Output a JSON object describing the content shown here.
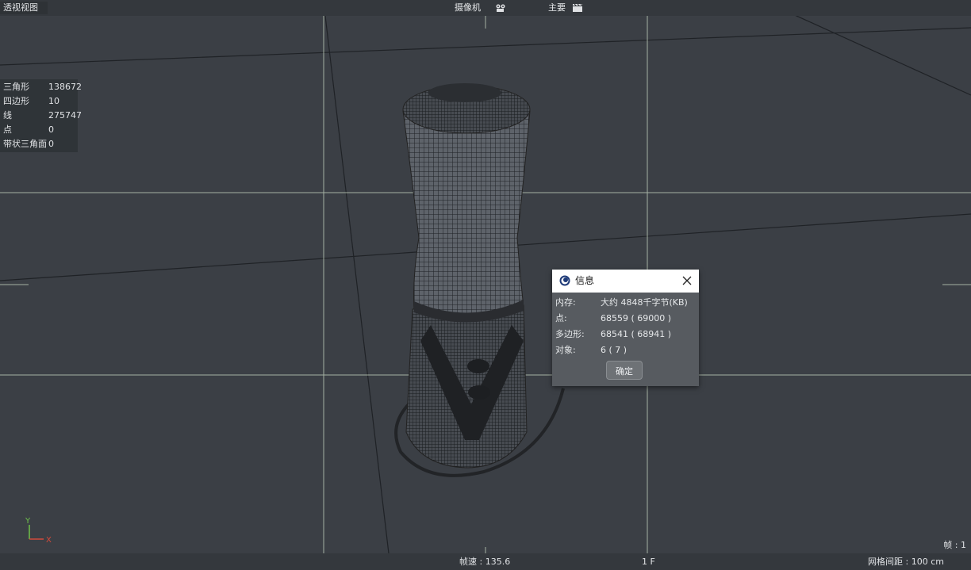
{
  "viewport": {
    "title": "透视视图",
    "camera_label": "摄像机",
    "camera_icon": "camera-icon",
    "display_label": "主要",
    "display_icon": "clapperboard-icon"
  },
  "stats": [
    {
      "label": "三角形",
      "value": "138672"
    },
    {
      "label": "四边形",
      "value": "10"
    },
    {
      "label": "线",
      "value": "275747"
    },
    {
      "label": "点",
      "value": "0"
    },
    {
      "label": "带状三角面",
      "value": "0"
    }
  ],
  "axis": {
    "y_label": "Y",
    "x_label": "X"
  },
  "dialog": {
    "title": "信息",
    "icon": "cinema4d-logo-icon",
    "rows": [
      {
        "label": "内存:",
        "value": "大约 4848千字节(KB)"
      },
      {
        "label": "点:",
        "value": "68559 ( 69000 )"
      },
      {
        "label": "多边形:",
        "value": "68541 ( 68941 )"
      },
      {
        "label": "对象:",
        "value": "6 ( 7 )"
      }
    ],
    "ok_label": "确定"
  },
  "status": {
    "fps": "帧速 : 135.6",
    "frame": "1 F",
    "grid_spacing": "网格间距 : 100 cm",
    "frame_counter": "帧 : 1"
  },
  "colors": {
    "viewport_bg": "#3b3f45",
    "grid_axis": "#b9c7b4",
    "grid_line": "#1e2024",
    "mesh_wire": "#2a2c30",
    "axis_y": "#6fc14a",
    "axis_x": "#d24a3c"
  }
}
